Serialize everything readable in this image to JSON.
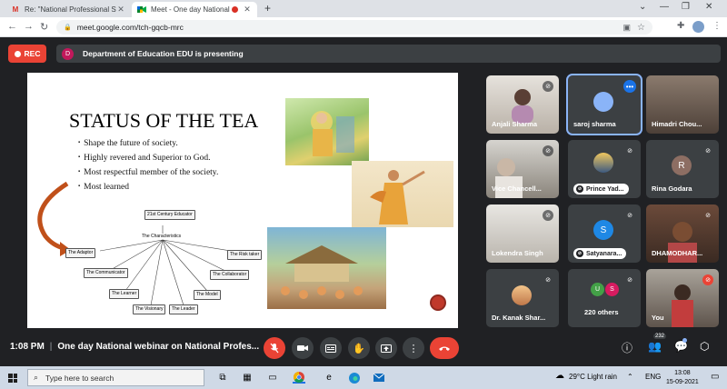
{
  "browser": {
    "tabs": [
      {
        "title": "Re: \"National Professional Standa",
        "favicon": "gmail-icon"
      },
      {
        "title": "Meet - One day National we",
        "favicon": "meet-icon",
        "recording": true
      }
    ],
    "url": "meet.google.com/tch-gqcb-mrc"
  },
  "meet": {
    "rec_label": "REC",
    "presenter_initial": "D",
    "presenting_text": "Department of Education EDU is presenting",
    "time": "1:08 PM",
    "meeting_title": "One day National webinar on National Profes...",
    "people_count": "232"
  },
  "slide": {
    "title": "STATUS OF THE TEA",
    "bullets": [
      "Shape the future of society.",
      "Highly revered and Superior to God.",
      "Most respectful member of the society.",
      "Most learned"
    ],
    "diagram": {
      "center": "21st Century Educator",
      "hub": "The Characteristics",
      "nodes": [
        "The Adaptor",
        "The Communicator",
        "The Learner",
        "The Visionary",
        "The Leader",
        "The Model",
        "The Collaborator",
        "The Risk taker"
      ]
    }
  },
  "participants": [
    {
      "name": "Anjali Sharma",
      "muted": true,
      "video": true
    },
    {
      "name": "saroj sharma",
      "muted": false,
      "video": true,
      "active": true
    },
    {
      "name": "Himadri Chou...",
      "muted": false,
      "video": true
    },
    {
      "name": "Vice Chancell...",
      "muted": true,
      "video": true
    },
    {
      "name": "Prince Yad...",
      "muted": true,
      "avatar_style": "image",
      "chip": true
    },
    {
      "name": "Rina Godara",
      "muted": true,
      "initial": "R",
      "avatar_color": "#8d6e63"
    },
    {
      "name": "Lokendra Singh",
      "muted": true,
      "video": true
    },
    {
      "name": "Satyanara...",
      "muted": true,
      "initial": "S",
      "avatar_color": "#1e88e5",
      "chip": true
    },
    {
      "name": "DHAMODHAR...",
      "muted": true,
      "video": true
    },
    {
      "name": "Dr. Kanak Shar...",
      "muted": true,
      "video": true
    },
    {
      "name": "220 others",
      "muted": true,
      "initials": [
        "U",
        "S"
      ],
      "avatar_colors": [
        "#43a047",
        "#d81b60"
      ]
    },
    {
      "name": "You",
      "muted": true,
      "video": true
    }
  ],
  "taskbar": {
    "search_placeholder": "Type here to search",
    "weather": "29°C  Light rain",
    "lang": "ENG",
    "time": "13:08",
    "date": "15-09-2021"
  }
}
